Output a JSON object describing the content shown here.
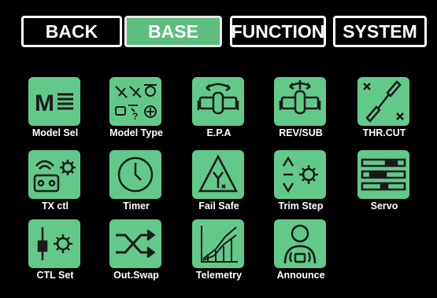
{
  "tabs": [
    {
      "label": "BACK",
      "active": false
    },
    {
      "label": "BASE",
      "active": true
    },
    {
      "label": "FUNCTION",
      "active": false
    },
    {
      "label": "SYSTEM",
      "active": false
    }
  ],
  "menu": [
    {
      "label": "Model Sel",
      "icon": "model-select-icon"
    },
    {
      "label": "Model Type",
      "icon": "model-type-icon"
    },
    {
      "label": "E.P.A",
      "icon": "end-point-adjust-icon"
    },
    {
      "label": "REV/SUB",
      "icon": "reverse-subtrim-icon"
    },
    {
      "label": "THR.CUT",
      "icon": "throttle-cut-icon"
    },
    {
      "label": "TX ctl",
      "icon": "transmitter-control-icon"
    },
    {
      "label": "Timer",
      "icon": "clock-icon"
    },
    {
      "label": "Fail Safe",
      "icon": "warning-antenna-icon"
    },
    {
      "label": "Trim Step",
      "icon": "trim-step-icon"
    },
    {
      "label": "Servo",
      "icon": "servo-bars-icon"
    },
    {
      "label": "CTL Set",
      "icon": "control-set-icon"
    },
    {
      "label": "Out.Swap",
      "icon": "output-swap-icon"
    },
    {
      "label": "Telemetry",
      "icon": "telemetry-chart-icon"
    },
    {
      "label": "Announce",
      "icon": "announce-person-icon"
    }
  ],
  "colors": {
    "tile": "#63c98a",
    "active_tab": "#5dbd7e",
    "icon_stroke": "#1a1a1a"
  }
}
